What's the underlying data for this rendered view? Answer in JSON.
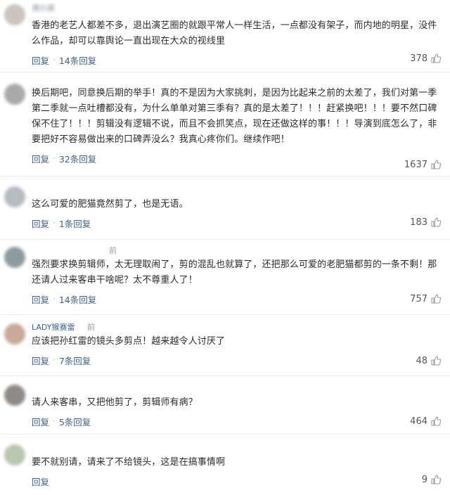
{
  "comments": [
    {
      "meta_user": "测小孩",
      "meta_time": "",
      "avatar_color": "#c9c4bd",
      "text": "香港的老艺人都差不多，退出演艺圈的就跟平常人一样生活，一点都没有架子，而内地的明星，没件么作品，却可以靠舆论一直出现在大众的视线里",
      "reply_label": "回复",
      "replies_label": "14条回复",
      "likes": "378"
    },
    {
      "meta_user": "",
      "meta_time": "",
      "avatar_color": "#a9a9a9",
      "text": "换后期吧，同意换后期的举手！真的不是因为大家挑刺，是因为比起来之前的太差了，我们对第一季第二季就一点吐槽都没有，为什么单单对第三季有？真的是太差了！！！赶紧换吧！！！要不然口碑保不住了！！！剪辑没有逻辑不说，而且不会抓笑点，现在还做这样的事！！！导演到底怎么了，非要把好不容易做出来的口碑弄没么？我真心疼你们。继续作吧！",
      "reply_label": "回复",
      "replies_label": "32条回复",
      "likes": "1637"
    },
    {
      "meta_user": "",
      "meta_time": "",
      "avatar_color": "#b7bcc2",
      "text": "这么可爱的肥猫竟然剪了，也是无语。",
      "reply_label": "回复",
      "replies_label": "1条回复",
      "likes": "183"
    },
    {
      "meta_user": "",
      "meta_time": "前",
      "avatar_color": "#8d9aa0",
      "text": "强烈要求换剪辑师，太无理取闹了，剪的混乱也就算了，还把那么可爱的老肥猫都剪的一条不剩！那还请人过来客串干啥呢？太不尊重人了！",
      "reply_label": "回复",
      "replies_label": "14条回复",
      "likes": "757"
    },
    {
      "meta_user": "LADY猴赛雷",
      "meta_time": "前",
      "avatar_color": "#c9a99a",
      "text": "应该把孙红雷的镜头多剪点！越来越令人讨厌了",
      "reply_label": "回复",
      "replies_label": "7条回复",
      "likes": "48"
    },
    {
      "meta_user": "",
      "meta_time": "",
      "avatar_color": "#8f8a86",
      "text": "请人来客串，又把他剪了，剪辑师有病？",
      "reply_label": "回复",
      "replies_label": "5条回复",
      "likes": "464"
    },
    {
      "meta_user": "",
      "meta_time": "",
      "avatar_color": "#b9c6b0",
      "text": "要不就别请，请来了不给镜头，这是在搞事情啊",
      "reply_label": "回复",
      "replies_label": "",
      "likes": "9"
    }
  ]
}
